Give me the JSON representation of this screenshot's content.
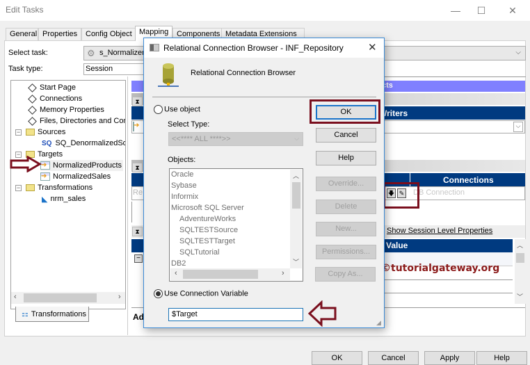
{
  "window": {
    "title": "Edit Tasks",
    "minimize_icon": "—",
    "maximize_icon": "☐",
    "close_icon": "✕"
  },
  "tabs": [
    {
      "label": "General",
      "active": false
    },
    {
      "label": "Properties",
      "active": false
    },
    {
      "label": "Config Object",
      "active": false
    },
    {
      "label": "Mapping",
      "active": true
    },
    {
      "label": "Components",
      "active": false
    },
    {
      "label": "Metadata Extensions",
      "active": false
    }
  ],
  "task": {
    "select_task_label": "Select task:",
    "select_task_value": "s_Normalizer",
    "task_type_label": "Task type:",
    "task_type_value": "Session"
  },
  "tree": {
    "items": [
      {
        "label": "Start Page",
        "icon": "diamond-icon"
      },
      {
        "label": "Connections",
        "icon": "diamond-icon"
      },
      {
        "label": "Memory Properties",
        "icon": "diamond-icon"
      },
      {
        "label": "Files, Directories and Commands",
        "icon": "diamond-icon"
      },
      {
        "label": "Sources",
        "icon": "folder-icon",
        "expander": "−"
      },
      {
        "label": "SQ_DenormalizedSource",
        "icon": "source-qualifier-icon",
        "badge": "SQ"
      },
      {
        "label": "Targets",
        "icon": "folder-icon",
        "expander": "−"
      },
      {
        "label": "NormalizedProducts",
        "icon": "target-icon",
        "selected": true
      },
      {
        "label": "NormalizedSales",
        "icon": "target-icon"
      },
      {
        "label": "Transformations",
        "icon": "folder-icon",
        "expander": "−"
      },
      {
        "label": "nrm_sales",
        "icon": "normalizer-icon"
      }
    ],
    "bottom_tab": "Transformations"
  },
  "right_panel": {
    "purple_band_text": "cts",
    "writers_header": "Writers",
    "connections_header": "Connections",
    "connection_placeholder": "DB Connection",
    "show_session_link": "Show Session Level Properties",
    "value_header": "Value",
    "partial_row_text": "Re",
    "partial_attr_text": "Ad"
  },
  "watermark": "©tutorialgateway.org",
  "dialog": {
    "title": "Relational Connection Browser - INF_Repository",
    "header_text": "Relational Connection Browser",
    "use_object_label": "Use object",
    "select_type_label": "Select Type:",
    "select_type_value": "<<**** ALL ****>>",
    "objects_label": "Objects:",
    "objects": [
      {
        "label": "Oracle",
        "indent": 0
      },
      {
        "label": "Sybase",
        "indent": 0
      },
      {
        "label": "Informix",
        "indent": 0
      },
      {
        "label": "Microsoft SQL Server",
        "indent": 0
      },
      {
        "label": "AdventureWorks",
        "indent": 1
      },
      {
        "label": "SQLTESTSource",
        "indent": 1
      },
      {
        "label": "SQLTESTTarget",
        "indent": 1
      },
      {
        "label": "SQLTutorial",
        "indent": 1
      },
      {
        "label": "DB2",
        "indent": 0
      }
    ],
    "use_connection_variable_label": "Use Connection Variable",
    "use_connection_variable_selected": true,
    "connection_variable_value": "$Target",
    "buttons": [
      {
        "label": "OK",
        "enabled": true
      },
      {
        "label": "Cancel",
        "enabled": true
      },
      {
        "label": "Help",
        "enabled": true
      },
      {
        "label": "Override...",
        "enabled": false
      },
      {
        "label": "Delete",
        "enabled": false
      },
      {
        "label": "New...",
        "enabled": false
      },
      {
        "label": "Permissions...",
        "enabled": false
      },
      {
        "label": "Copy As...",
        "enabled": false
      }
    ]
  },
  "footer_buttons": [
    "OK",
    "Cancel",
    "Apply",
    "Help"
  ],
  "colors": {
    "annotation_red": "#7a0f1e",
    "navy_header": "#003a80",
    "purple_band": "#8080ff",
    "dialog_border": "#3b8ad6"
  }
}
